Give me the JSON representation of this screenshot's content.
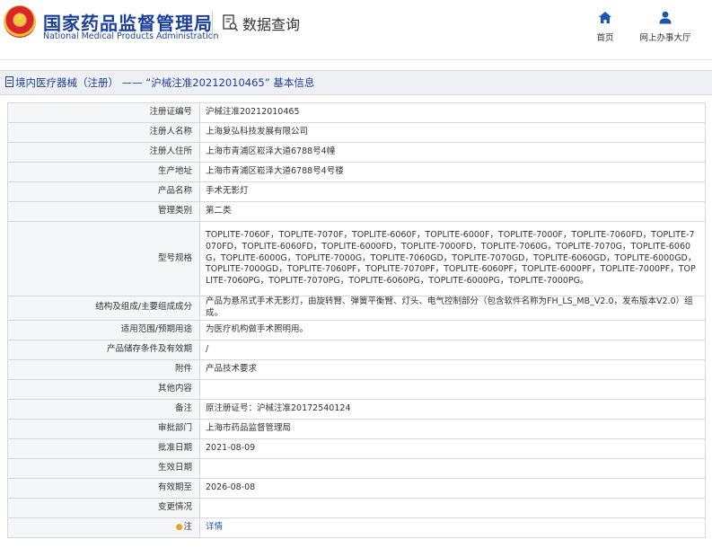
{
  "header": {
    "org_cn": "国家药品监督管理局",
    "org_en": "National Medical Products Administration",
    "query_label": "数据查询",
    "nav": [
      {
        "label": "首页",
        "icon": "home-icon"
      },
      {
        "label": "网上办事大厅",
        "icon": "user-icon"
      }
    ]
  },
  "page_title": "境内医疗器械（注册） —— “沪械注准20212010465” 基本信息",
  "rows": [
    {
      "label": "注册证编号",
      "value": "沪械注准20212010465"
    },
    {
      "label": "注册人名称",
      "value": "上海复弘科技发展有限公司"
    },
    {
      "label": "注册人住所",
      "value": "上海市青浦区崧泽大道6788号4幢"
    },
    {
      "label": "生产地址",
      "value": "上海市青浦区崧泽大道6788号4号楼"
    },
    {
      "label": "产品名称",
      "value": "手术无影灯"
    },
    {
      "label": "管理类别",
      "value": "第二类"
    },
    {
      "label": "型号规格",
      "value": "TOPLITE-7060F，TOPLITE-7070F，TOPLITE-6060F，TOPLITE-6000F，TOPLITE-7000F，TOPLITE-7060FD，TOPLITE-7070FD，TOPLITE-6060FD，TOPLITE-6000FD，TOPLITE-7000FD，TOPLITE-7060G，TOPLITE-7070G，TOPLITE-6060G，TOPLITE-6000G，TOPLITE-7000G，TOPLITE-7060GD，TOPLITE-7070GD，TOPLITE-6060GD，TOPLITE-6000GD，TOPLITE-7000GD，TOPLITE-7060PF，TOPLITE-7070PF，TOPLITE-6060PF，TOPLITE-6000PF，TOPLITE-7000PF，TOPLITE-7060PG，TOPLITE-7070PG，TOPLITE-6060PG，TOPLITE-6000PG，TOPLITE-7000PG。"
    },
    {
      "label": "结构及组成/主要组成成分",
      "value": "产品为悬吊式手术无影灯，由旋转臂、弹簧平衡臂、灯头、电气控制部分（包含软件名称为FH_LS_MB_V2.0，发布版本V2.0）组成。"
    },
    {
      "label": "适用范围/预期用途",
      "value": "为医疗机构做手术照明用。"
    },
    {
      "label": "产品储存条件及有效期",
      "value": "/"
    },
    {
      "label": "附件",
      "value": "产品技术要求"
    },
    {
      "label": "其他内容",
      "value": ""
    },
    {
      "label": "备注",
      "value": "原注册证号：沪械注准20172540124"
    },
    {
      "label": "审批部门",
      "value": "上海市药品监督管理局"
    },
    {
      "label": "批准日期",
      "value": "2021-08-09"
    },
    {
      "label": "生效日期",
      "value": ""
    },
    {
      "label": "有效期至",
      "value": "2026-08-08"
    },
    {
      "label": "变更情况",
      "value": ""
    },
    {
      "label": "注",
      "value": "详情",
      "icon": "bulb-icon"
    }
  ]
}
